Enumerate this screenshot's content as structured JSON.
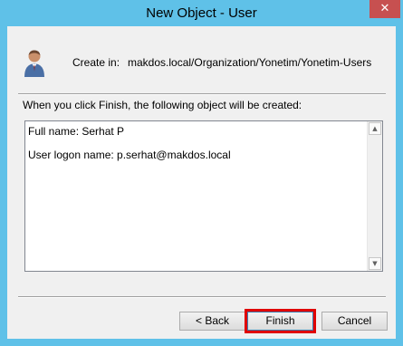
{
  "window": {
    "title": "New Object - User",
    "close_glyph": "✕"
  },
  "header": {
    "icon": "user-icon",
    "create_in_label": "Create in:",
    "create_in_path": "makdos.local/Organization/Yonetim/Yonetim-Users"
  },
  "intro_text": "When you click Finish, the following object will be created:",
  "summary": {
    "full_name": "Full name: Serhat P",
    "logon_name": "User logon name: p.serhat@makdos.local"
  },
  "scrollbar": {
    "up_glyph": "▲",
    "down_glyph": "▼"
  },
  "buttons": {
    "back": "< Back",
    "finish": "Finish",
    "cancel": "Cancel"
  },
  "colors": {
    "title_bar": "#5fc1e8",
    "close": "#c75050",
    "highlight": "#e00000"
  }
}
